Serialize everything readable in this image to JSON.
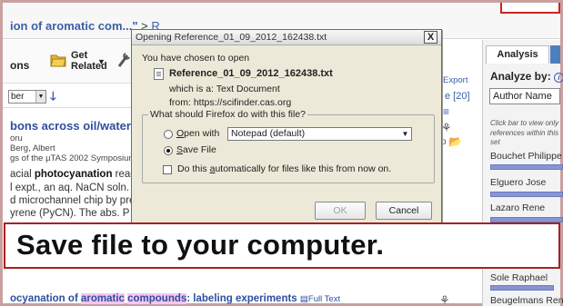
{
  "breadcrumb": {
    "title": "ion of aromatic com...\"",
    "sep": ">",
    "next": "R"
  },
  "toolbar": {
    "partial_label": "ons",
    "get_related": "Get\nRelated",
    "sort_value": "ber"
  },
  "results_mid": {
    "export": "Export",
    "page": "e [20]"
  },
  "result1": {
    "title": "bons across oil/water inte",
    "author1": "oru",
    "author2": "Berg, Albert",
    "source": "gs of the µTAS 2002 Symposium,",
    "abs1a": "acial ",
    "abs1b": "photocyanation",
    "abs1c": " reac",
    "abs2": "l expt., an aq. NaCN soln. a",
    "abs3": "d microchannel chip by pre",
    "abs4": "yrene (PyCN).  The abs. P"
  },
  "result2": {
    "t1": "ocyanation",
    "t2": " of ",
    "t3": "aromatic",
    "t4": " ",
    "t5": "compounds",
    "t6": ": labeling experiments ",
    "fulltext": "Full Text"
  },
  "analysis": {
    "tab": "Analysis",
    "analyze_by": "Analyze by:",
    "select_value": "Author Name",
    "hint": "Click bar to view only references within this set",
    "authors": [
      "Bouchet Philippe",
      "Elguero Jose",
      "Lazaro Rene",
      "Sole Raphael",
      "Beugelmans Rene"
    ]
  },
  "dialog": {
    "title": "Opening Reference_01_09_2012_162438.txt",
    "close": "X",
    "chosen": "You have chosen to open",
    "filename": "Reference_01_09_2012_162438.txt",
    "which_is": "which is a:  Text Document",
    "from": "from:  https://scifinder.cas.org",
    "question": "What should Firefox do with this file?",
    "open_with": "Open with",
    "open_with_app": "Notepad (default)",
    "save_file": "Save File",
    "checkbox_label": "Do this automatically for files like this from now on.",
    "ok": "OK",
    "cancel": "Cancel"
  },
  "caption": "Save file to your computer.",
  "icons": {
    "close": "close-icon",
    "text-file": "text-file-icon",
    "info": "info-icon",
    "sort": "sort-down-arrow-icon",
    "folder": "folder-icon",
    "tools": "tools-icon"
  }
}
